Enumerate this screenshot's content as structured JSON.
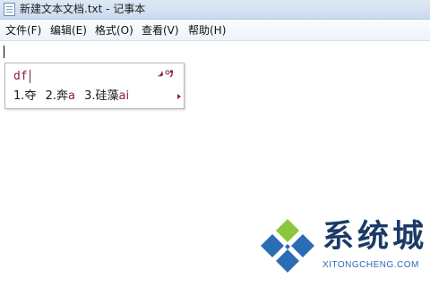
{
  "window": {
    "title": "新建文本文档.txt - 记事本"
  },
  "menu": {
    "file": "文件(F)",
    "edit": "编辑(E)",
    "format": "格式(O)",
    "view": "查看(V)",
    "help": "帮助(H)"
  },
  "editor": {
    "content": ""
  },
  "ime": {
    "composition": "df",
    "candidates": [
      {
        "index": "1.",
        "text": "夺",
        "pinyin": ""
      },
      {
        "index": "2.",
        "text": "奔",
        "pinyin": "a"
      },
      {
        "index": "3.",
        "text": "硅藻",
        "pinyin": "ai"
      }
    ],
    "logo_icon": "ime-logo-icon",
    "next_icon": "next-page-arrow-icon"
  },
  "watermark": {
    "title": "系统城",
    "subtitle": "XITONGCHENG.COM",
    "logo_icon": "diamond-logo-icon"
  },
  "colors": {
    "titlebar": "#c9dbef",
    "menubar": "#eef3f9",
    "ime_accent": "#8a1c4e",
    "watermark_dark": "#1b3b66",
    "watermark_blue": "#2b6db5",
    "watermark_green": "#8bc63e"
  }
}
